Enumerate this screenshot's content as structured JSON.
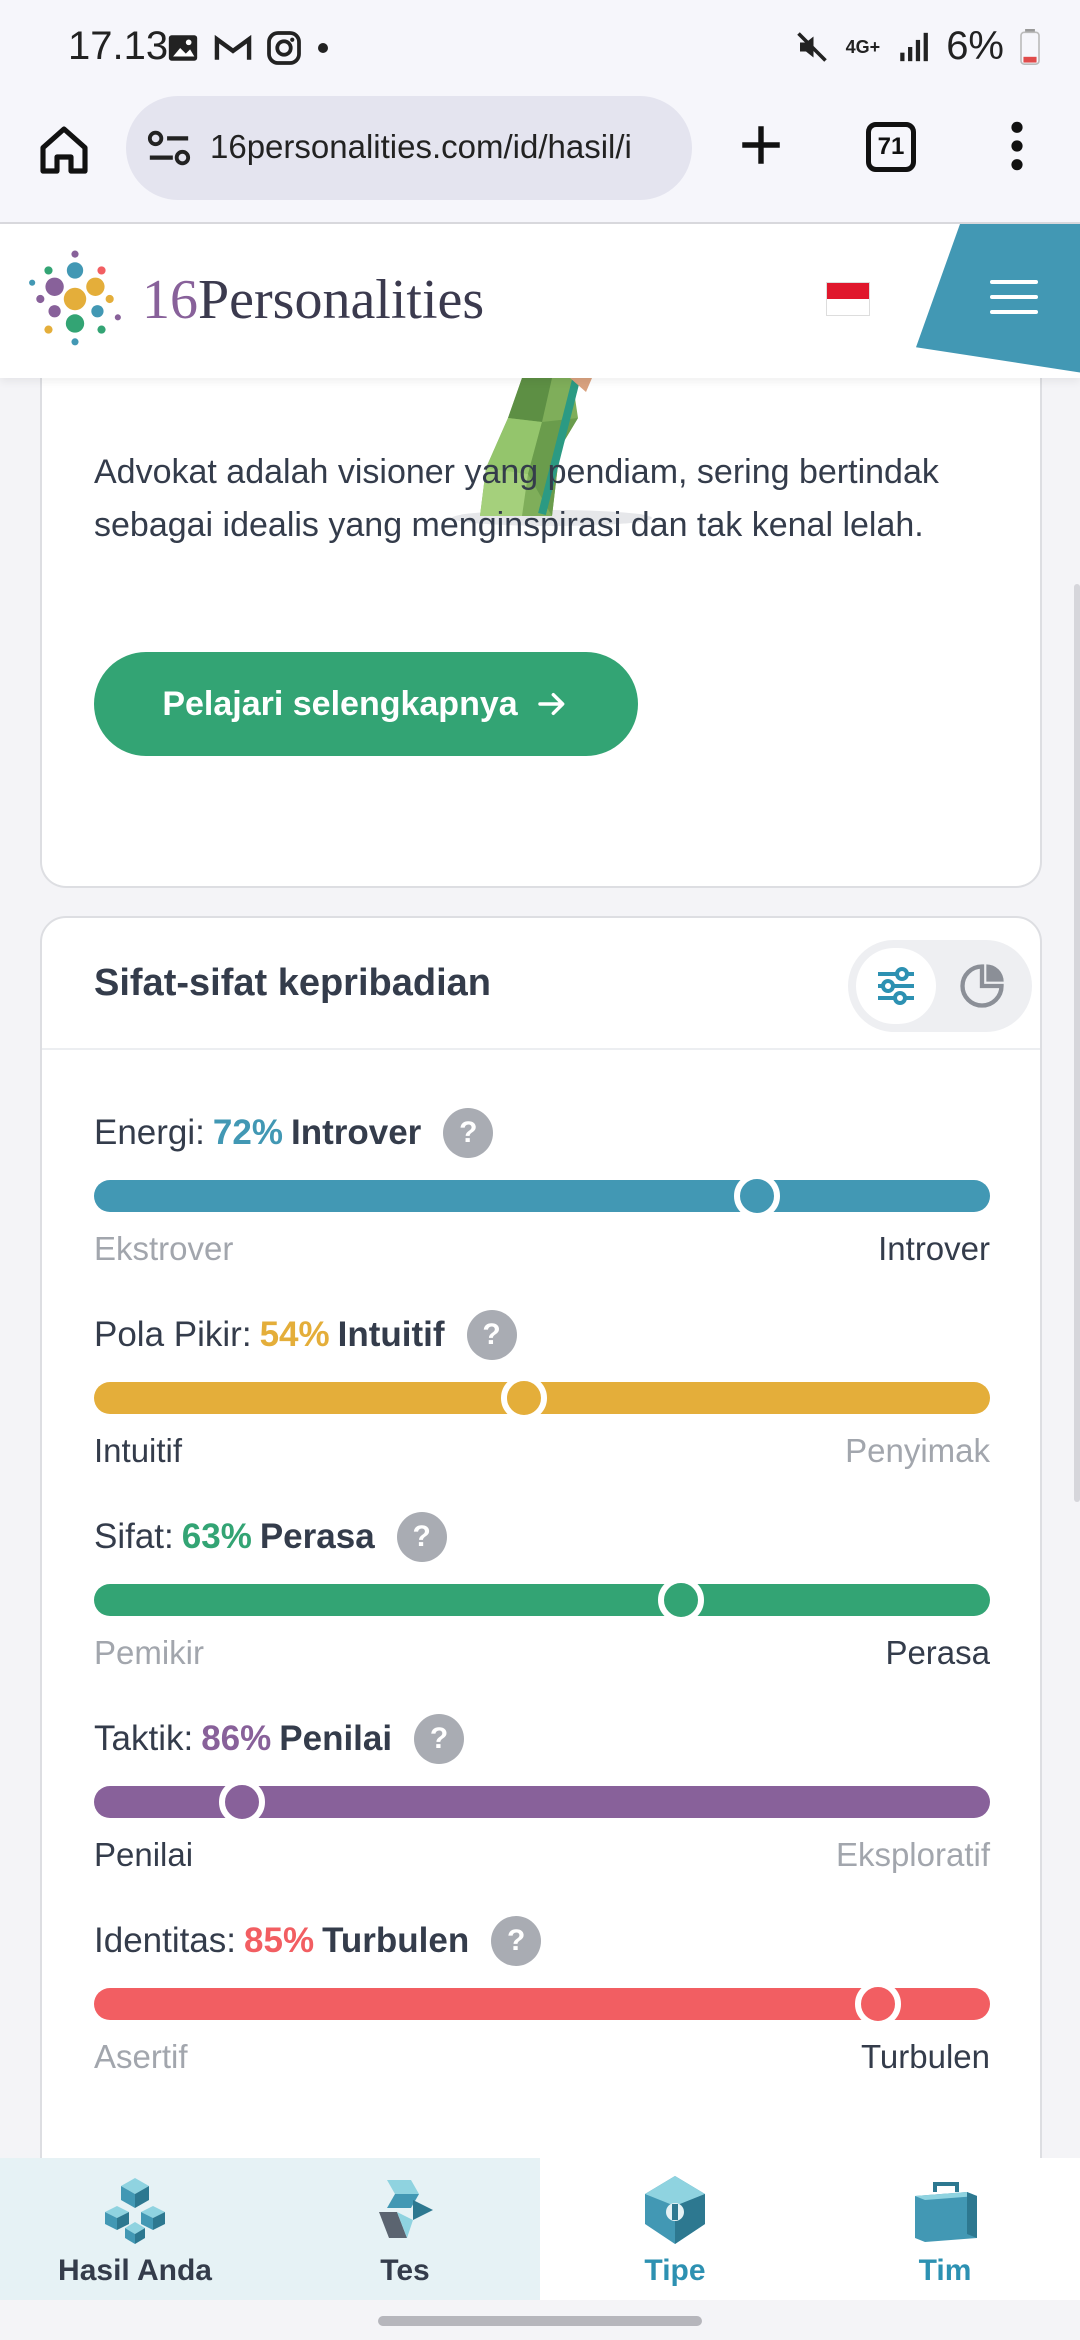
{
  "status_bar": {
    "time": "17.13",
    "network": "4G+",
    "battery": "6%"
  },
  "browser": {
    "url": "16personalities.com/id/hasil/i",
    "tab_count": "71"
  },
  "site": {
    "brand_number": "16",
    "brand_name": "Personalities",
    "flag": "Indonesia"
  },
  "intro": {
    "description": "Advokat adalah visioner yang pendiam, sering bertindak sebagai idealis yang menginspirasi dan tak kenal lelah.",
    "learn_more": "Pelajari selengkapnya"
  },
  "traits_card": {
    "title": "Sifat-sifat kepribadian",
    "traits": [
      {
        "label": "Energi:",
        "percent": "72%",
        "name": "Introver",
        "value": 0.74,
        "left": "Ekstrover",
        "right": "Introver",
        "active": "right",
        "color": "#4298b4"
      },
      {
        "label": "Pola Pikir:",
        "percent": "54%",
        "name": "Intuitif",
        "value": 0.48,
        "left": "Intuitif",
        "right": "Penyimak",
        "active": "left",
        "color": "#e4ae3a"
      },
      {
        "label": "Sifat:",
        "percent": "63%",
        "name": "Perasa",
        "value": 0.655,
        "left": "Pemikir",
        "right": "Perasa",
        "active": "right",
        "color": "#33a474"
      },
      {
        "label": "Taktik:",
        "percent": "86%",
        "name": "Penilai",
        "value": 0.165,
        "left": "Penilai",
        "right": "Eksploratif",
        "active": "left",
        "color": "#88619a"
      },
      {
        "label": "Identitas:",
        "percent": "85%",
        "name": "Turbulen",
        "value": 0.875,
        "left": "Asertif",
        "right": "Turbulen",
        "active": "right",
        "color": "#f25e62"
      }
    ],
    "help_symbol": "?"
  },
  "bottom_nav": [
    {
      "label": "Hasil Anda",
      "icon": "results-cubes-icon",
      "color": "#343c4b"
    },
    {
      "label": "Tes",
      "icon": "test-shapes-icon",
      "color": "#343c4b"
    },
    {
      "label": "Tipe",
      "icon": "types-gem-icon",
      "color": "#2d91b2"
    },
    {
      "label": "Tim",
      "icon": "team-briefcase-icon",
      "color": "#2d91b2"
    }
  ]
}
